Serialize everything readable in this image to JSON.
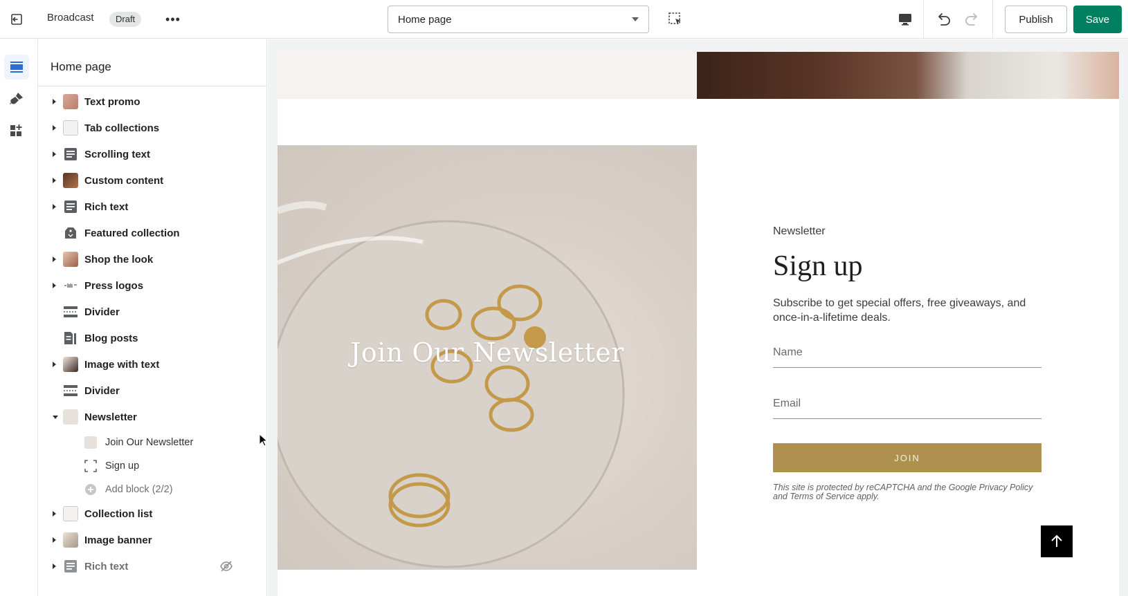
{
  "topbar": {
    "theme_name": "Broadcast",
    "badge": "Draft",
    "more": "•••",
    "page_select": "Home page",
    "publish_label": "Publish",
    "save_label": "Save",
    "save_color": "#008060"
  },
  "rail": {
    "items": [
      {
        "icon": "sections-icon",
        "active": true
      },
      {
        "icon": "theme-settings-brush-icon",
        "active": false
      },
      {
        "icon": "app-embeds-icon",
        "active": false
      }
    ]
  },
  "panel": {
    "title": "Home page",
    "sections": [
      {
        "label": "Text promo",
        "icon": "thumbnail",
        "caret": "right"
      },
      {
        "label": "Tab collections",
        "icon": "thumbnail",
        "caret": "right"
      },
      {
        "label": "Scrolling text",
        "icon": "text-icon",
        "caret": "right"
      },
      {
        "label": "Custom content",
        "icon": "thumbnail",
        "caret": "right"
      },
      {
        "label": "Rich text",
        "icon": "text-icon",
        "caret": "right"
      },
      {
        "label": "Featured collection",
        "icon": "tag-icon",
        "caret": "none"
      },
      {
        "label": "Shop the look",
        "icon": "thumbnail",
        "caret": "right"
      },
      {
        "label": "Press logos",
        "icon": "thumbnail",
        "caret": "right"
      },
      {
        "label": "Divider",
        "icon": "divider-icon",
        "caret": "none"
      },
      {
        "label": "Blog posts",
        "icon": "blog-icon",
        "caret": "none"
      },
      {
        "label": "Image with text",
        "icon": "thumbnail",
        "caret": "right"
      },
      {
        "label": "Divider",
        "icon": "divider-icon",
        "caret": "none"
      },
      {
        "label": "Newsletter",
        "icon": "thumbnail",
        "caret": "down"
      },
      {
        "label": "Join Our Newsletter",
        "icon": "thumbnail",
        "child": true
      },
      {
        "label": "Sign up",
        "icon": "block-icon",
        "child": true
      },
      {
        "label": "Add block (2/2)",
        "icon": "add-circle-icon",
        "child": true,
        "muted": true
      },
      {
        "label": "Collection list",
        "icon": "thumbnail",
        "caret": "right"
      },
      {
        "label": "Image banner",
        "icon": "thumbnail",
        "caret": "right"
      },
      {
        "label": "Rich text",
        "icon": "text-icon",
        "caret": "right",
        "hidden": true
      }
    ]
  },
  "preview": {
    "image_overlay_title": "Join Our Newsletter",
    "kicker": "Newsletter",
    "heading": "Sign up",
    "description": "Subscribe to get special offers, free giveaways, and once-in-a-lifetime deals.",
    "name_placeholder": "Name",
    "email_placeholder": "Email",
    "join_label": "JOIN",
    "join_color": "#ae914e",
    "legal": "This site is protected by reCAPTCHA and the Google Privacy Policy and Terms of Service apply."
  }
}
